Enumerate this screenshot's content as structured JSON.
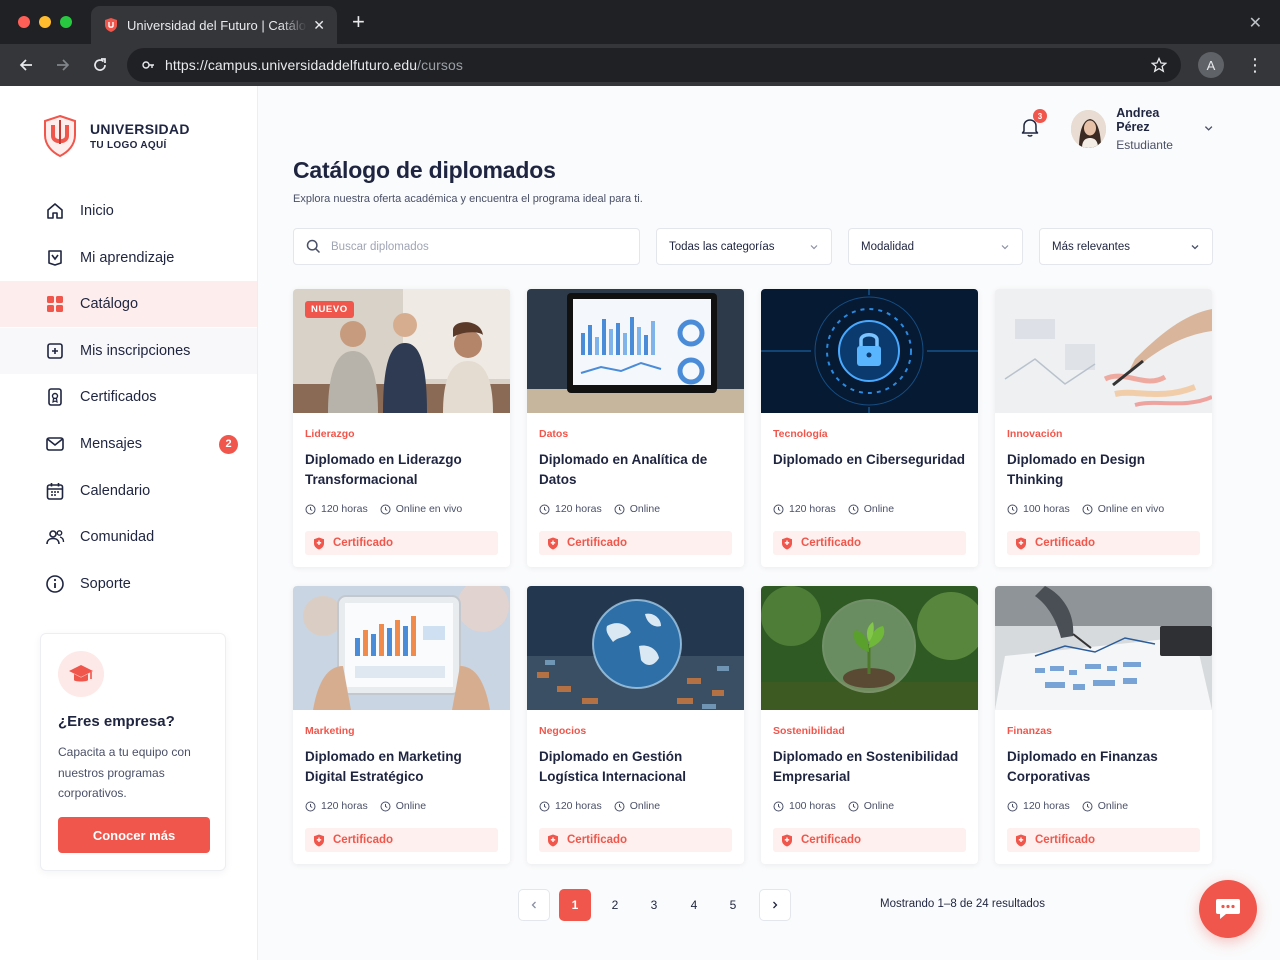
{
  "browser": {
    "tab_title": "Universidad del Futuro | Catálogo de diplomados",
    "url_host": "https://campus.universidaddelfuturo.edu",
    "url_path": "/cursos",
    "profile_initial": "A"
  },
  "sidebar": {
    "logo_line1": "UNIVERSIDAD",
    "logo_line2": "TU LOGO AQUÍ",
    "items": [
      {
        "label": "Inicio",
        "icon": "home-icon"
      },
      {
        "label": "Mi aprendizaje",
        "icon": "book-icon"
      },
      {
        "label": "Catálogo",
        "icon": "grid-icon",
        "active": true
      },
      {
        "label": "Mis inscripciones",
        "icon": "enroll-icon"
      },
      {
        "label": "Certificados",
        "icon": "certificate-icon"
      },
      {
        "label": "Mensajes",
        "icon": "mail-icon",
        "badge": "2"
      },
      {
        "label": "Calendario",
        "icon": "calendar-icon"
      },
      {
        "label": "Comunidad",
        "icon": "users-icon"
      },
      {
        "label": "Soporte",
        "icon": "help-icon"
      }
    ],
    "promo": {
      "title": "¿Eres empresa?",
      "text": "Capacita a tu equipo con nuestros programas corporativos.",
      "button": "Conocer más"
    }
  },
  "header": {
    "notifications": "3",
    "user_name": "Andrea Pérez",
    "user_role": "Estudiante"
  },
  "main": {
    "title": "Catálogo de diplomados",
    "subtitle": "Explora nuestra oferta académica y encuentra el programa ideal para ti.",
    "search_placeholder": "Buscar diplomados",
    "filters": {
      "category": "Todas las categorías",
      "modality": "Modalidad",
      "sort": "Más relevantes"
    }
  },
  "courses": [
    {
      "category": "Liderazgo",
      "title": "Diplomado en Liderazgo Transformacional",
      "hours": "120 horas",
      "mode": "Online en vivo",
      "cert": "Certificado",
      "badge": "NUEVO"
    },
    {
      "category": "Datos",
      "title": "Diplomado en Analítica de Datos",
      "hours": "120 horas",
      "mode": "Online",
      "cert": "Certificado"
    },
    {
      "category": "Tecnología",
      "title": "Diplomado en Ciberseguridad",
      "hours": "120 horas",
      "mode": "Online",
      "cert": "Certificado"
    },
    {
      "category": "Innovación",
      "title": "Diplomado en Design Thinking",
      "hours": "100 horas",
      "mode": "Online en vivo",
      "cert": "Certificado"
    },
    {
      "category": "Marketing",
      "title": "Diplomado en Marketing Digital Estratégico",
      "hours": "120 horas",
      "mode": "Online",
      "cert": "Certificado"
    },
    {
      "category": "Negocios",
      "title": "Diplomado en Gestión Logística Internacional",
      "hours": "120 horas",
      "mode": "Online",
      "cert": "Certificado"
    },
    {
      "category": "Sostenibilidad",
      "title": "Diplomado en Sostenibilidad Empresarial",
      "hours": "100 horas",
      "mode": "Online",
      "cert": "Certificado"
    },
    {
      "category": "Finanzas",
      "title": "Diplomado en Finanzas Corporativas",
      "hours": "120 horas",
      "mode": "Online",
      "cert": "Certificado"
    }
  ],
  "pagination": {
    "pages": [
      "1",
      "2",
      "3",
      "4",
      "5"
    ],
    "current": "1",
    "results": "Mostrando 1–8 de 24 resultados"
  },
  "colors": {
    "accent": "#f0564b",
    "text": "#1f2540",
    "active_bg": "#fdeeed"
  }
}
